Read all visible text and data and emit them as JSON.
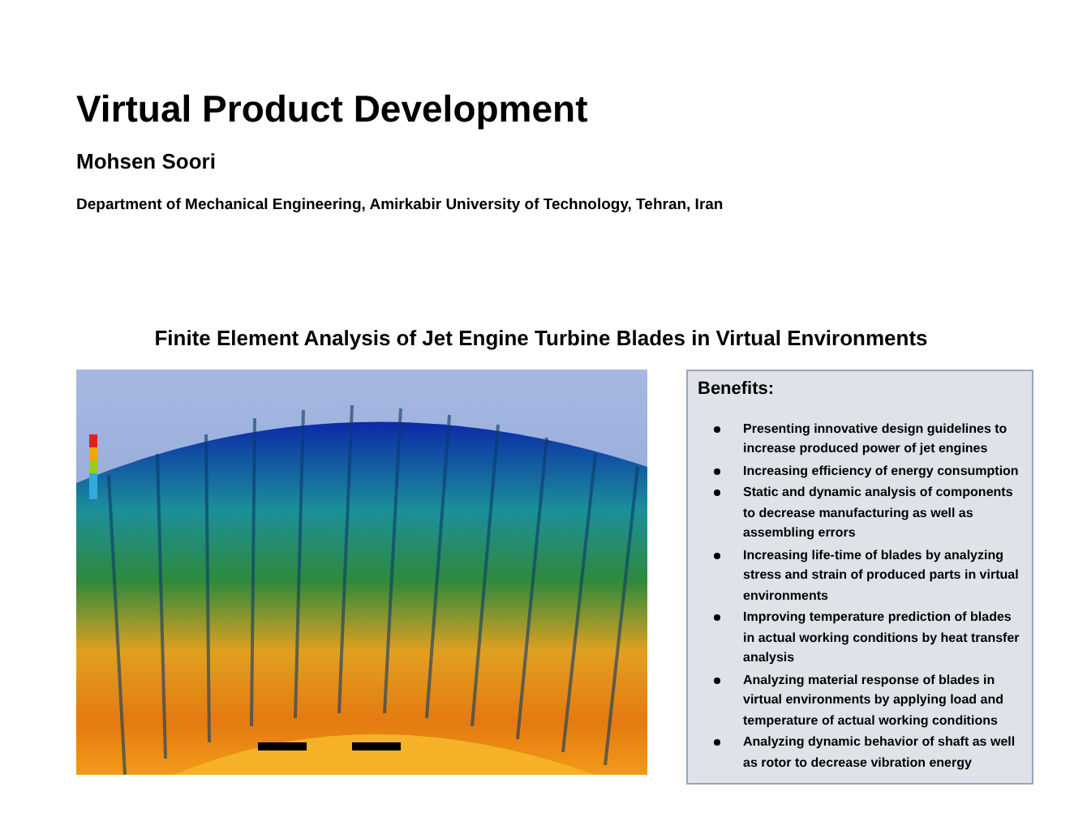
{
  "title": "Virtual Product Development",
  "author": "Mohsen Soori",
  "affiliation": "Department of Mechanical Engineering, Amirkabir University of Technology, Tehran, Iran",
  "figure": {
    "caption": "Finite Element Analysis of Jet Engine Turbine Blades in Virtual Environments"
  },
  "benefits": {
    "heading": "Benefits:",
    "items": [
      "Presenting innovative design guidelines to increase produced power of jet engines",
      "Increasing efficiency of energy consumption",
      "Static and dynamic analysis of components to decrease manufacturing as well as assembling errors",
      "Increasing life-time of blades by analyzing stress and strain of produced parts in virtual environments",
      "Improving temperature prediction of blades in actual working conditions by heat transfer analysis",
      "Analyzing material response of blades in virtual environments by applying load and temperature of actual working conditions",
      "Analyzing dynamic behavior of shaft as well as rotor to decrease vibration energy"
    ]
  }
}
